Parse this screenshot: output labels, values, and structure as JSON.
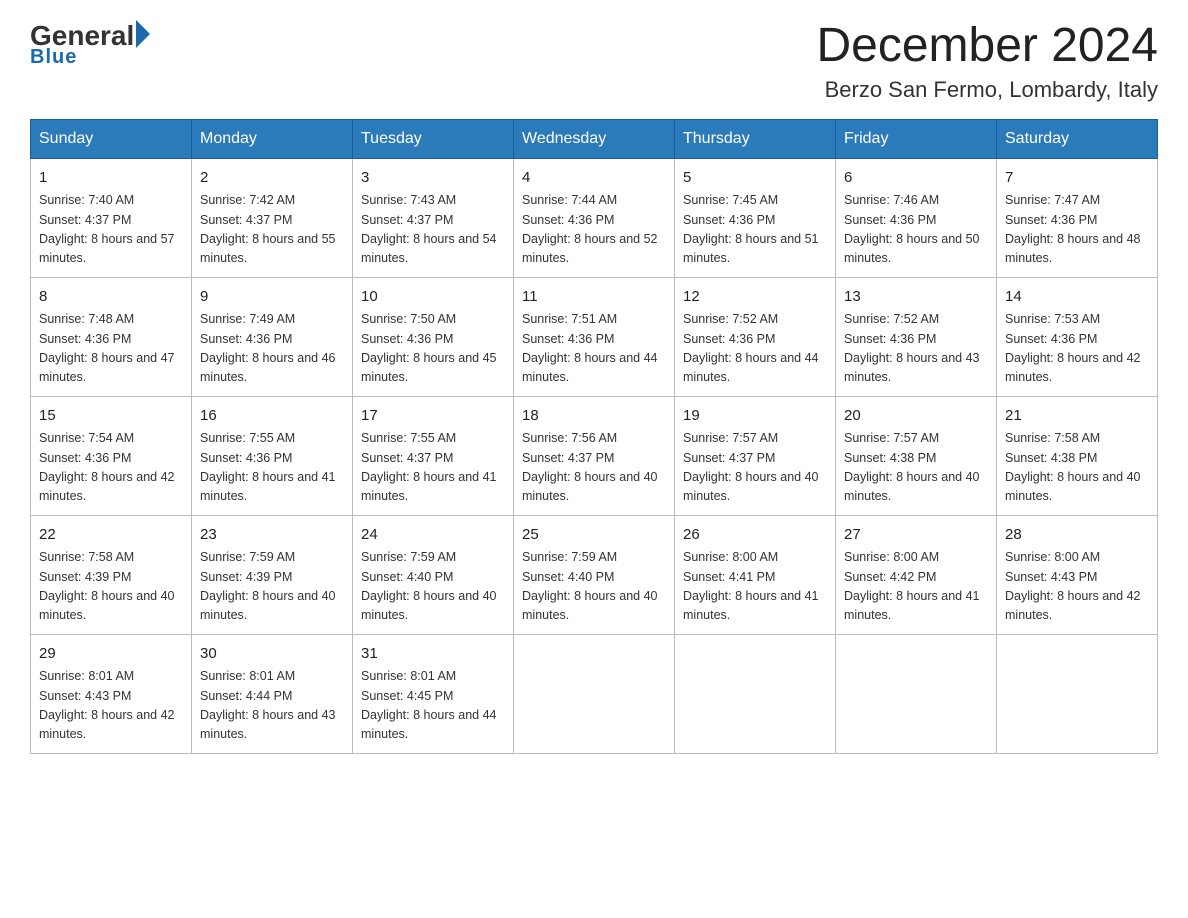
{
  "logo": {
    "general": "General",
    "triangle": "",
    "blue": "Blue"
  },
  "title": "December 2024",
  "subtitle": "Berzo San Fermo, Lombardy, Italy",
  "weekdays": [
    "Sunday",
    "Monday",
    "Tuesday",
    "Wednesday",
    "Thursday",
    "Friday",
    "Saturday"
  ],
  "weeks": [
    [
      {
        "day": "1",
        "sunrise": "7:40 AM",
        "sunset": "4:37 PM",
        "daylight": "8 hours and 57 minutes."
      },
      {
        "day": "2",
        "sunrise": "7:42 AM",
        "sunset": "4:37 PM",
        "daylight": "8 hours and 55 minutes."
      },
      {
        "day": "3",
        "sunrise": "7:43 AM",
        "sunset": "4:37 PM",
        "daylight": "8 hours and 54 minutes."
      },
      {
        "day": "4",
        "sunrise": "7:44 AM",
        "sunset": "4:36 PM",
        "daylight": "8 hours and 52 minutes."
      },
      {
        "day": "5",
        "sunrise": "7:45 AM",
        "sunset": "4:36 PM",
        "daylight": "8 hours and 51 minutes."
      },
      {
        "day": "6",
        "sunrise": "7:46 AM",
        "sunset": "4:36 PM",
        "daylight": "8 hours and 50 minutes."
      },
      {
        "day": "7",
        "sunrise": "7:47 AM",
        "sunset": "4:36 PM",
        "daylight": "8 hours and 48 minutes."
      }
    ],
    [
      {
        "day": "8",
        "sunrise": "7:48 AM",
        "sunset": "4:36 PM",
        "daylight": "8 hours and 47 minutes."
      },
      {
        "day": "9",
        "sunrise": "7:49 AM",
        "sunset": "4:36 PM",
        "daylight": "8 hours and 46 minutes."
      },
      {
        "day": "10",
        "sunrise": "7:50 AM",
        "sunset": "4:36 PM",
        "daylight": "8 hours and 45 minutes."
      },
      {
        "day": "11",
        "sunrise": "7:51 AM",
        "sunset": "4:36 PM",
        "daylight": "8 hours and 44 minutes."
      },
      {
        "day": "12",
        "sunrise": "7:52 AM",
        "sunset": "4:36 PM",
        "daylight": "8 hours and 44 minutes."
      },
      {
        "day": "13",
        "sunrise": "7:52 AM",
        "sunset": "4:36 PM",
        "daylight": "8 hours and 43 minutes."
      },
      {
        "day": "14",
        "sunrise": "7:53 AM",
        "sunset": "4:36 PM",
        "daylight": "8 hours and 42 minutes."
      }
    ],
    [
      {
        "day": "15",
        "sunrise": "7:54 AM",
        "sunset": "4:36 PM",
        "daylight": "8 hours and 42 minutes."
      },
      {
        "day": "16",
        "sunrise": "7:55 AM",
        "sunset": "4:36 PM",
        "daylight": "8 hours and 41 minutes."
      },
      {
        "day": "17",
        "sunrise": "7:55 AM",
        "sunset": "4:37 PM",
        "daylight": "8 hours and 41 minutes."
      },
      {
        "day": "18",
        "sunrise": "7:56 AM",
        "sunset": "4:37 PM",
        "daylight": "8 hours and 40 minutes."
      },
      {
        "day": "19",
        "sunrise": "7:57 AM",
        "sunset": "4:37 PM",
        "daylight": "8 hours and 40 minutes."
      },
      {
        "day": "20",
        "sunrise": "7:57 AM",
        "sunset": "4:38 PM",
        "daylight": "8 hours and 40 minutes."
      },
      {
        "day": "21",
        "sunrise": "7:58 AM",
        "sunset": "4:38 PM",
        "daylight": "8 hours and 40 minutes."
      }
    ],
    [
      {
        "day": "22",
        "sunrise": "7:58 AM",
        "sunset": "4:39 PM",
        "daylight": "8 hours and 40 minutes."
      },
      {
        "day": "23",
        "sunrise": "7:59 AM",
        "sunset": "4:39 PM",
        "daylight": "8 hours and 40 minutes."
      },
      {
        "day": "24",
        "sunrise": "7:59 AM",
        "sunset": "4:40 PM",
        "daylight": "8 hours and 40 minutes."
      },
      {
        "day": "25",
        "sunrise": "7:59 AM",
        "sunset": "4:40 PM",
        "daylight": "8 hours and 40 minutes."
      },
      {
        "day": "26",
        "sunrise": "8:00 AM",
        "sunset": "4:41 PM",
        "daylight": "8 hours and 41 minutes."
      },
      {
        "day": "27",
        "sunrise": "8:00 AM",
        "sunset": "4:42 PM",
        "daylight": "8 hours and 41 minutes."
      },
      {
        "day": "28",
        "sunrise": "8:00 AM",
        "sunset": "4:43 PM",
        "daylight": "8 hours and 42 minutes."
      }
    ],
    [
      {
        "day": "29",
        "sunrise": "8:01 AM",
        "sunset": "4:43 PM",
        "daylight": "8 hours and 42 minutes."
      },
      {
        "day": "30",
        "sunrise": "8:01 AM",
        "sunset": "4:44 PM",
        "daylight": "8 hours and 43 minutes."
      },
      {
        "day": "31",
        "sunrise": "8:01 AM",
        "sunset": "4:45 PM",
        "daylight": "8 hours and 44 minutes."
      },
      null,
      null,
      null,
      null
    ]
  ]
}
